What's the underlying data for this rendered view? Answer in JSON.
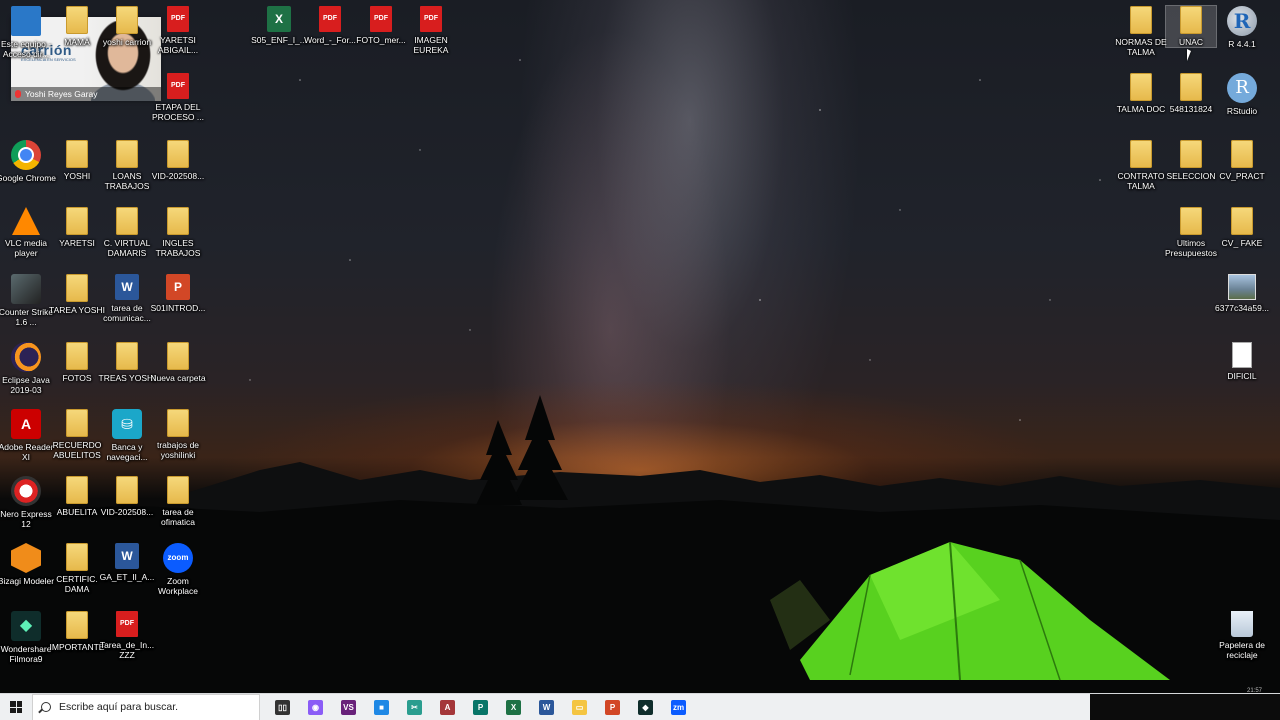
{
  "desktop": {
    "icons": [
      {
        "label": "Este equipo - Acceso dir...",
        "type": "pc"
      },
      {
        "label": "MAMÁ",
        "type": "folder"
      },
      {
        "label": "yoshi carrion",
        "type": "folder"
      },
      {
        "label": "YARETSI ABIGAIL...",
        "type": "pdf"
      },
      {
        "label": "ETAPA DEL PROCESO ...",
        "type": "pdf"
      },
      {
        "label": "S05_ENF_I_...",
        "type": "xls"
      },
      {
        "label": "Word_-_For...",
        "type": "pdf"
      },
      {
        "label": "FOTO_mer...",
        "type": "pdf"
      },
      {
        "label": "IMAGEN EUREKA",
        "type": "pdf"
      },
      {
        "label": "Google Chrome",
        "type": "chrome"
      },
      {
        "label": "YOSHI",
        "type": "folder"
      },
      {
        "label": "LOANS TRABAJOS",
        "type": "folder"
      },
      {
        "label": "VID-202508...",
        "type": "folder"
      },
      {
        "label": "VLC media player",
        "type": "vlc"
      },
      {
        "label": "YARETSI",
        "type": "folder"
      },
      {
        "label": "C. VIRTUAL DAMARIS",
        "type": "folder"
      },
      {
        "label": "INGLES TRABAJOS",
        "type": "folder"
      },
      {
        "label": "Counter Strike 1.6 ...",
        "type": "cs"
      },
      {
        "label": "TAREA YOSHI",
        "type": "folder"
      },
      {
        "label": "tarea de comunicac...",
        "type": "doc"
      },
      {
        "label": "S01INTROD...",
        "type": "ppt"
      },
      {
        "label": "Eclipse Java 2019-03",
        "type": "eclipse"
      },
      {
        "label": "FOTOS",
        "type": "folder"
      },
      {
        "label": "TREAS YOSHI",
        "type": "folder"
      },
      {
        "label": "Nueva carpeta",
        "type": "folder"
      },
      {
        "label": "Adobe Reader XI",
        "type": "adobe"
      },
      {
        "label": "RECUERDO ABUELITOS",
        "type": "folder"
      },
      {
        "label": "Banca y navegaci...",
        "type": "bank"
      },
      {
        "label": "trabajos de yoshilinki",
        "type": "folder"
      },
      {
        "label": "Nero Express 12",
        "type": "nero"
      },
      {
        "label": "ABUELITA",
        "type": "folder"
      },
      {
        "label": "VID-202508...",
        "type": "folder"
      },
      {
        "label": "tarea de ofimatica",
        "type": "folder"
      },
      {
        "label": "Bizagi Modeler",
        "type": "bizagi"
      },
      {
        "label": "CERTIFIC. DAMA",
        "type": "folder"
      },
      {
        "label": "GA_ET_II_A...",
        "type": "doc"
      },
      {
        "label": "Zoom Workplace",
        "type": "zoom"
      },
      {
        "label": "Wondershare Filmora9",
        "type": "filmora"
      },
      {
        "label": "IMPORTANTE",
        "type": "folder"
      },
      {
        "label": "Tarea_de_In... ZZZ",
        "type": "pdf"
      },
      {
        "label": "NORMAS DE TALMA",
        "type": "folder"
      },
      {
        "label": "UNAC",
        "type": "folder"
      },
      {
        "label": "R 4.4.1",
        "type": "r"
      },
      {
        "label": "TALMA DOC",
        "type": "folder"
      },
      {
        "label": "548131824",
        "type": "folder"
      },
      {
        "label": "RStudio",
        "type": "rstudio"
      },
      {
        "label": "CONTRATO TALMA",
        "type": "folder"
      },
      {
        "label": "SELECCION",
        "type": "folder"
      },
      {
        "label": "CV_PRACT",
        "type": "folder"
      },
      {
        "label": "Ultimos Presupuestos",
        "type": "folder"
      },
      {
        "label": "CV_ FAKE",
        "type": "folder"
      },
      {
        "label": "6377c34a59...",
        "type": "image"
      },
      {
        "label": "DIFICIL",
        "type": "text"
      },
      {
        "label": "Papelera de reciclaje",
        "type": "recycle"
      }
    ],
    "selected_icon": "UNAC"
  },
  "webcam": {
    "brand": "carrión",
    "brand_sub": "EXCELENCIA EN SERVICIOS",
    "participant_name": "Yoshi Reyes Garay"
  },
  "taskbar": {
    "search_placeholder": "Escribe aquí para buscar.",
    "apps": [
      {
        "name": "task-view",
        "glyph": "▯▯",
        "color": "#333333"
      },
      {
        "name": "copilot",
        "glyph": "◉",
        "color": "#8a5cf6"
      },
      {
        "name": "visual-studio",
        "glyph": "VS",
        "color": "#68217a"
      },
      {
        "name": "store",
        "glyph": "■",
        "color": "#1e88e5"
      },
      {
        "name": "snip",
        "glyph": "✂",
        "color": "#2a9d8f"
      },
      {
        "name": "access",
        "glyph": "A",
        "color": "#a4373a"
      },
      {
        "name": "publisher",
        "glyph": "P",
        "color": "#077568"
      },
      {
        "name": "excel",
        "glyph": "X",
        "color": "#1e7145"
      },
      {
        "name": "word",
        "glyph": "W",
        "color": "#2b579a"
      },
      {
        "name": "file-explorer",
        "glyph": "▭",
        "color": "#f4c542"
      },
      {
        "name": "powerpoint",
        "glyph": "P",
        "color": "#d24726"
      },
      {
        "name": "filmora",
        "glyph": "◆",
        "color": "#0f2d2b"
      },
      {
        "name": "zoom",
        "glyph": "zm",
        "color": "#0b5cff"
      }
    ],
    "clock_partial": "21:57"
  }
}
